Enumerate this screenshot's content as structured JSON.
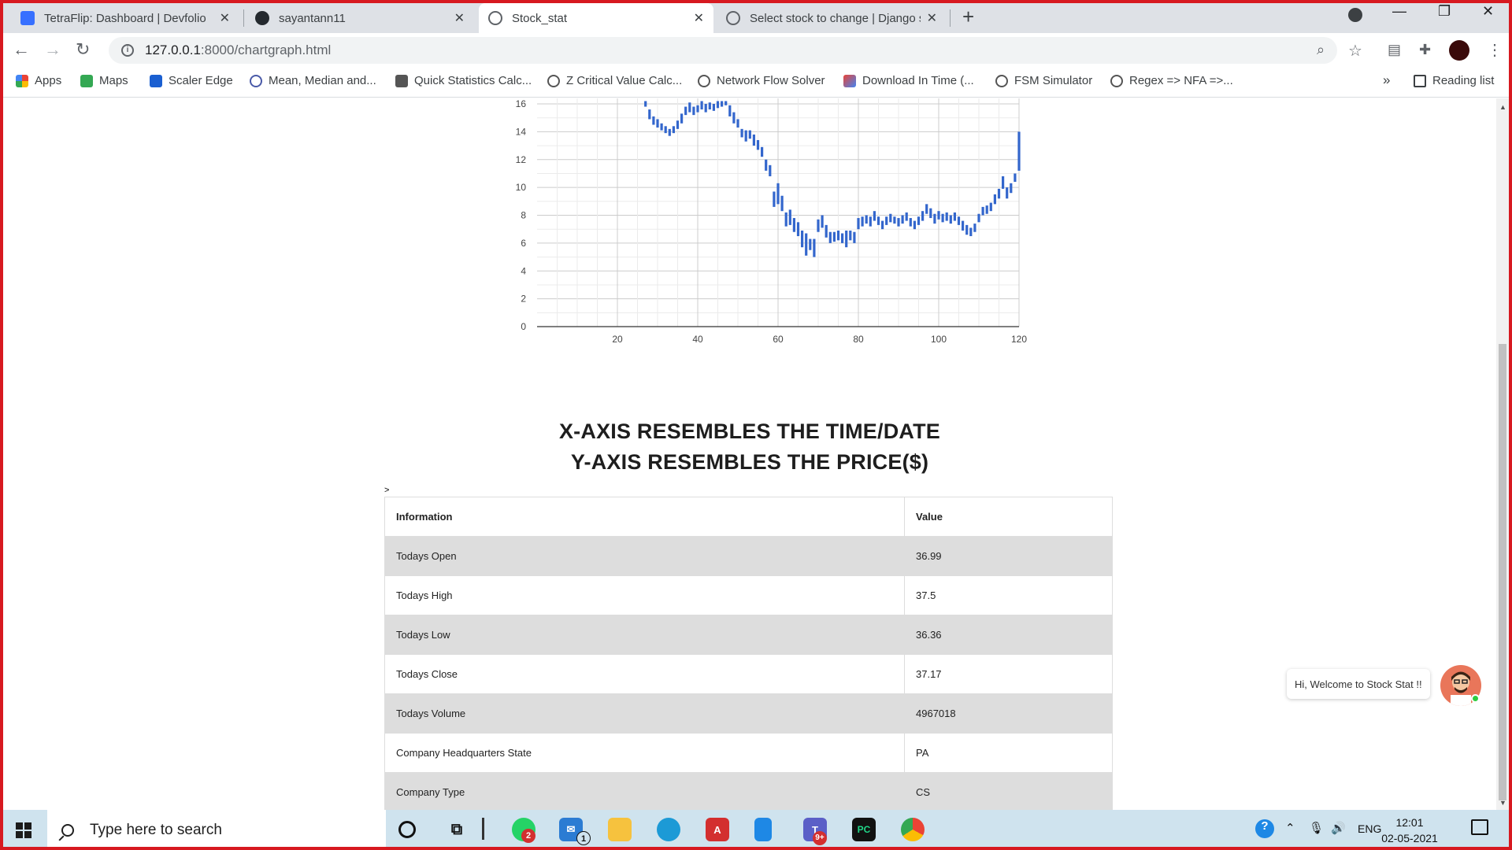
{
  "browser": {
    "tabs": [
      {
        "title": "TetraFlip: Dashboard | Devfolio",
        "active": false,
        "favicon": "devfolio-icon",
        "color": "#3770ff"
      },
      {
        "title": "sayantann11",
        "active": false,
        "favicon": "github-icon",
        "color": "#24292e"
      },
      {
        "title": "Stock_stat",
        "active": true,
        "favicon": "globe-icon",
        "color": "#5f6368"
      },
      {
        "title": "Select stock to change | Django s",
        "active": false,
        "favicon": "globe-icon",
        "color": "#5f6368"
      }
    ],
    "url_host": "127.0.0.1",
    "url_path": ":8000/chartgraph.html",
    "bookmarks": [
      {
        "label": "Apps",
        "icon": "apps-grid-icon"
      },
      {
        "label": "Maps",
        "icon": "maps-icon"
      },
      {
        "label": "Scaler Edge",
        "icon": "scaler-icon"
      },
      {
        "label": "Mean, Median and...",
        "icon": "atom-icon"
      },
      {
        "label": "Quick Statistics Calc...",
        "icon": "calculator-icon"
      },
      {
        "label": "Z Critical Value Calc...",
        "icon": "globe-icon"
      },
      {
        "label": "Network Flow Solver",
        "icon": "globe-icon"
      },
      {
        "label": "Download In Time (...",
        "icon": "gmail-icon"
      },
      {
        "label": "FSM Simulator",
        "icon": "globe-icon"
      },
      {
        "label": "Regex => NFA =>...",
        "icon": "globe-icon"
      }
    ],
    "more_bookmarks": "»",
    "reading_list": "Reading list"
  },
  "chart_data": {
    "type": "candlestick",
    "title": "",
    "xlabel": "",
    "ylabel": "",
    "xlim": [
      0,
      120
    ],
    "ylim": [
      0,
      16
    ],
    "x_ticks": [
      20,
      40,
      60,
      80,
      100,
      120
    ],
    "y_ticks": [
      0,
      2,
      4,
      6,
      8,
      10,
      12,
      14,
      16
    ],
    "grid": true,
    "color": "#3366cc",
    "candles": [
      {
        "x": 27,
        "low": 15.8,
        "high": 16.6
      },
      {
        "x": 28,
        "low": 14.9,
        "high": 15.6
      },
      {
        "x": 29,
        "low": 14.5,
        "high": 15.1
      },
      {
        "x": 30,
        "low": 14.3,
        "high": 14.9
      },
      {
        "x": 31,
        "low": 14.1,
        "high": 14.6
      },
      {
        "x": 32,
        "low": 13.9,
        "high": 14.4
      },
      {
        "x": 33,
        "low": 13.7,
        "high": 14.2
      },
      {
        "x": 34,
        "low": 13.9,
        "high": 14.4
      },
      {
        "x": 35,
        "low": 14.2,
        "high": 14.8
      },
      {
        "x": 36,
        "low": 14.6,
        "high": 15.3
      },
      {
        "x": 37,
        "low": 15.2,
        "high": 15.8
      },
      {
        "x": 38,
        "low": 15.4,
        "high": 16.1
      },
      {
        "x": 39,
        "low": 15.2,
        "high": 15.8
      },
      {
        "x": 40,
        "low": 15.4,
        "high": 15.9
      },
      {
        "x": 41,
        "low": 15.6,
        "high": 16.2
      },
      {
        "x": 42,
        "low": 15.4,
        "high": 16.0
      },
      {
        "x": 43,
        "low": 15.6,
        "high": 16.1
      },
      {
        "x": 44,
        "low": 15.5,
        "high": 16.0
      },
      {
        "x": 45,
        "low": 15.7,
        "high": 16.2
      },
      {
        "x": 46,
        "low": 15.8,
        "high": 16.3
      },
      {
        "x": 47,
        "low": 15.9,
        "high": 16.5
      },
      {
        "x": 48,
        "low": 15.1,
        "high": 15.9
      },
      {
        "x": 49,
        "low": 14.6,
        "high": 15.4
      },
      {
        "x": 50,
        "low": 14.3,
        "high": 14.9
      },
      {
        "x": 51,
        "low": 13.6,
        "high": 14.2
      },
      {
        "x": 52,
        "low": 13.3,
        "high": 14.1
      },
      {
        "x": 53,
        "low": 13.5,
        "high": 14.1
      },
      {
        "x": 54,
        "low": 13.0,
        "high": 13.8
      },
      {
        "x": 55,
        "low": 12.7,
        "high": 13.4
      },
      {
        "x": 56,
        "low": 12.2,
        "high": 12.9
      },
      {
        "x": 57,
        "low": 11.2,
        "high": 12.0
      },
      {
        "x": 58,
        "low": 10.8,
        "high": 11.6
      },
      {
        "x": 59,
        "low": 8.6,
        "high": 9.7
      },
      {
        "x": 60,
        "low": 8.8,
        "high": 10.3
      },
      {
        "x": 61,
        "low": 8.3,
        "high": 9.4
      },
      {
        "x": 62,
        "low": 7.2,
        "high": 8.2
      },
      {
        "x": 63,
        "low": 7.3,
        "high": 8.4
      },
      {
        "x": 64,
        "low": 6.8,
        "high": 7.8
      },
      {
        "x": 65,
        "low": 6.5,
        "high": 7.5
      },
      {
        "x": 66,
        "low": 5.7,
        "high": 6.9
      },
      {
        "x": 67,
        "low": 5.1,
        "high": 6.7
      },
      {
        "x": 68,
        "low": 5.5,
        "high": 6.3
      },
      {
        "x": 69,
        "low": 5.0,
        "high": 6.3
      },
      {
        "x": 70,
        "low": 6.8,
        "high": 7.7
      },
      {
        "x": 71,
        "low": 7.1,
        "high": 8.0
      },
      {
        "x": 72,
        "low": 6.4,
        "high": 7.3
      },
      {
        "x": 73,
        "low": 6.0,
        "high": 6.8
      },
      {
        "x": 74,
        "low": 6.1,
        "high": 6.8
      },
      {
        "x": 75,
        "low": 6.2,
        "high": 6.9
      },
      {
        "x": 76,
        "low": 6.0,
        "high": 6.7
      },
      {
        "x": 77,
        "low": 5.7,
        "high": 6.9
      },
      {
        "x": 78,
        "low": 6.2,
        "high": 6.9
      },
      {
        "x": 79,
        "low": 6.0,
        "high": 6.8
      },
      {
        "x": 80,
        "low": 7.0,
        "high": 7.8
      },
      {
        "x": 81,
        "low": 7.2,
        "high": 7.9
      },
      {
        "x": 82,
        "low": 7.4,
        "high": 8.0
      },
      {
        "x": 83,
        "low": 7.2,
        "high": 7.9
      },
      {
        "x": 84,
        "low": 7.6,
        "high": 8.3
      },
      {
        "x": 85,
        "low": 7.3,
        "high": 7.9
      },
      {
        "x": 86,
        "low": 7.0,
        "high": 7.6
      },
      {
        "x": 87,
        "low": 7.3,
        "high": 7.9
      },
      {
        "x": 88,
        "low": 7.5,
        "high": 8.1
      },
      {
        "x": 89,
        "low": 7.4,
        "high": 7.9
      },
      {
        "x": 90,
        "low": 7.2,
        "high": 7.8
      },
      {
        "x": 91,
        "low": 7.4,
        "high": 8.0
      },
      {
        "x": 92,
        "low": 7.6,
        "high": 8.2
      },
      {
        "x": 93,
        "low": 7.2,
        "high": 7.8
      },
      {
        "x": 94,
        "low": 7.0,
        "high": 7.6
      },
      {
        "x": 95,
        "low": 7.3,
        "high": 7.9
      },
      {
        "x": 96,
        "low": 7.6,
        "high": 8.3
      },
      {
        "x": 97,
        "low": 8.1,
        "high": 8.8
      },
      {
        "x": 98,
        "low": 7.8,
        "high": 8.5
      },
      {
        "x": 99,
        "low": 7.4,
        "high": 8.1
      },
      {
        "x": 100,
        "low": 7.7,
        "high": 8.3
      },
      {
        "x": 101,
        "low": 7.5,
        "high": 8.1
      },
      {
        "x": 102,
        "low": 7.6,
        "high": 8.2
      },
      {
        "x": 103,
        "low": 7.4,
        "high": 8.0
      },
      {
        "x": 104,
        "low": 7.6,
        "high": 8.2
      },
      {
        "x": 105,
        "low": 7.3,
        "high": 7.9
      },
      {
        "x": 106,
        "low": 6.9,
        "high": 7.6
      },
      {
        "x": 107,
        "low": 6.6,
        "high": 7.3
      },
      {
        "x": 108,
        "low": 6.5,
        "high": 7.1
      },
      {
        "x": 109,
        "low": 6.8,
        "high": 7.4
      },
      {
        "x": 110,
        "low": 7.5,
        "high": 8.1
      },
      {
        "x": 111,
        "low": 8.0,
        "high": 8.6
      },
      {
        "x": 112,
        "low": 8.1,
        "high": 8.7
      },
      {
        "x": 113,
        "low": 8.3,
        "high": 8.9
      },
      {
        "x": 114,
        "low": 8.8,
        "high": 9.5
      },
      {
        "x": 115,
        "low": 9.2,
        "high": 9.9
      },
      {
        "x": 116,
        "low": 9.9,
        "high": 10.8
      },
      {
        "x": 117,
        "low": 9.2,
        "high": 10.0
      },
      {
        "x": 118,
        "low": 9.6,
        "high": 10.3
      },
      {
        "x": 119,
        "low": 10.4,
        "high": 11.0
      },
      {
        "x": 120,
        "low": 11.2,
        "high": 14.0
      }
    ]
  },
  "page": {
    "heading_line1": "X-AXIS RESEMBLES THE TIME/DATE",
    "heading_line2": "Y-AXIS RESEMBLES THE PRICE($)",
    "stray_text": ">",
    "table": {
      "header": [
        "Information",
        "Value"
      ],
      "rows": [
        [
          "Todays Open",
          "36.99"
        ],
        [
          "Todays High",
          "37.5"
        ],
        [
          "Todays Low",
          "36.36"
        ],
        [
          "Todays Close",
          "37.17"
        ],
        [
          "Todays Volume",
          "4967018"
        ],
        [
          "Company Headquarters State",
          "PA"
        ],
        [
          "Company Type",
          "CS"
        ]
      ]
    },
    "chat_greeting": "Hi, Welcome to Stock Stat !!"
  },
  "taskbar": {
    "search_placeholder": "Type here to search",
    "whatsapp_badge": "2",
    "mail_badge": "1",
    "teams_badge": "9+",
    "language": "ENG",
    "time": "12:01",
    "date": "02-05-2021"
  }
}
